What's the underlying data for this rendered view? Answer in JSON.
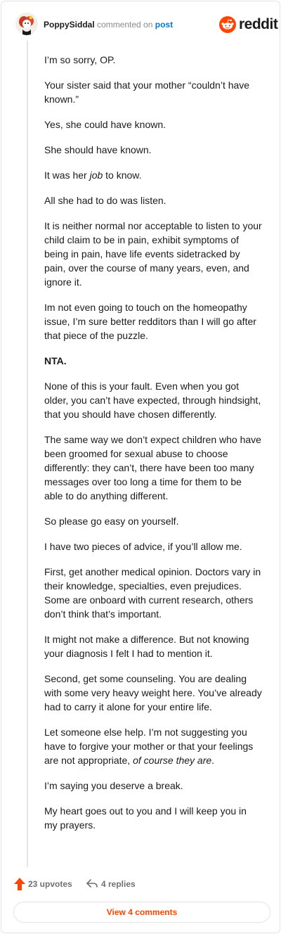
{
  "header": {
    "username": "PoppySiddal",
    "action_text": "commented on",
    "target_text": "post",
    "brand_name": "reddit",
    "brand_color": "#ff4500"
  },
  "comment": {
    "paragraphs": [
      "I’m so sorry, OP.",
      "Your sister said that your mother “couldn’t have known.”",
      "Yes, she could have known.",
      "She should have known.",
      "It was her ",
      "All she had to do was listen.",
      "It is neither normal nor acceptable to listen to your child claim to be in pain, exhibit symptoms of being in pain, have life events sidetracked by pain, over the course of many years, even, and ignore it.",
      "Im not even going to touch on the homeopathy issue, I’m sure better redditors than I will go after that piece of the puzzle.",
      "NTA.",
      "None of this is your fault. Even when you got older, you can’t have expected, through hindsight, that you should have chosen differently.",
      "The same way we don’t expect children who have been groomed for sexual abuse to choose differently: they can’t, there have been too many messages over too long a time for them to be able to do anything different.",
      "So please go easy on yourself.",
      "I have two pieces of advice, if you’ll allow me.",
      "First, get another medical opinion. Doctors vary in their knowledge, specialties, even prejudices. Some are onboard with current research, others don’t think that’s important.",
      "It might not make a difference. But not knowing your diagnosis I felt I had to mention it.",
      "Second, get some counseling. You are dealing with some very heavy weight here. You’ve already had to carry it alone for your entire life.",
      "Let someone else help. I’m not suggesting you have to forgive your mother or that your feelings are not appropriate, ",
      "I’m saying you deserve a break.",
      "My heart goes out to you and I will keep you in my prayers."
    ],
    "p5_em": "job",
    "p5_tail": " to know.",
    "p17_em": "of course they are",
    "p17_tail": "."
  },
  "footer": {
    "upvotes": "23 upvotes",
    "replies": "4 replies",
    "view_comments": "View 4 comments",
    "upvote_color": "#ff4500"
  }
}
